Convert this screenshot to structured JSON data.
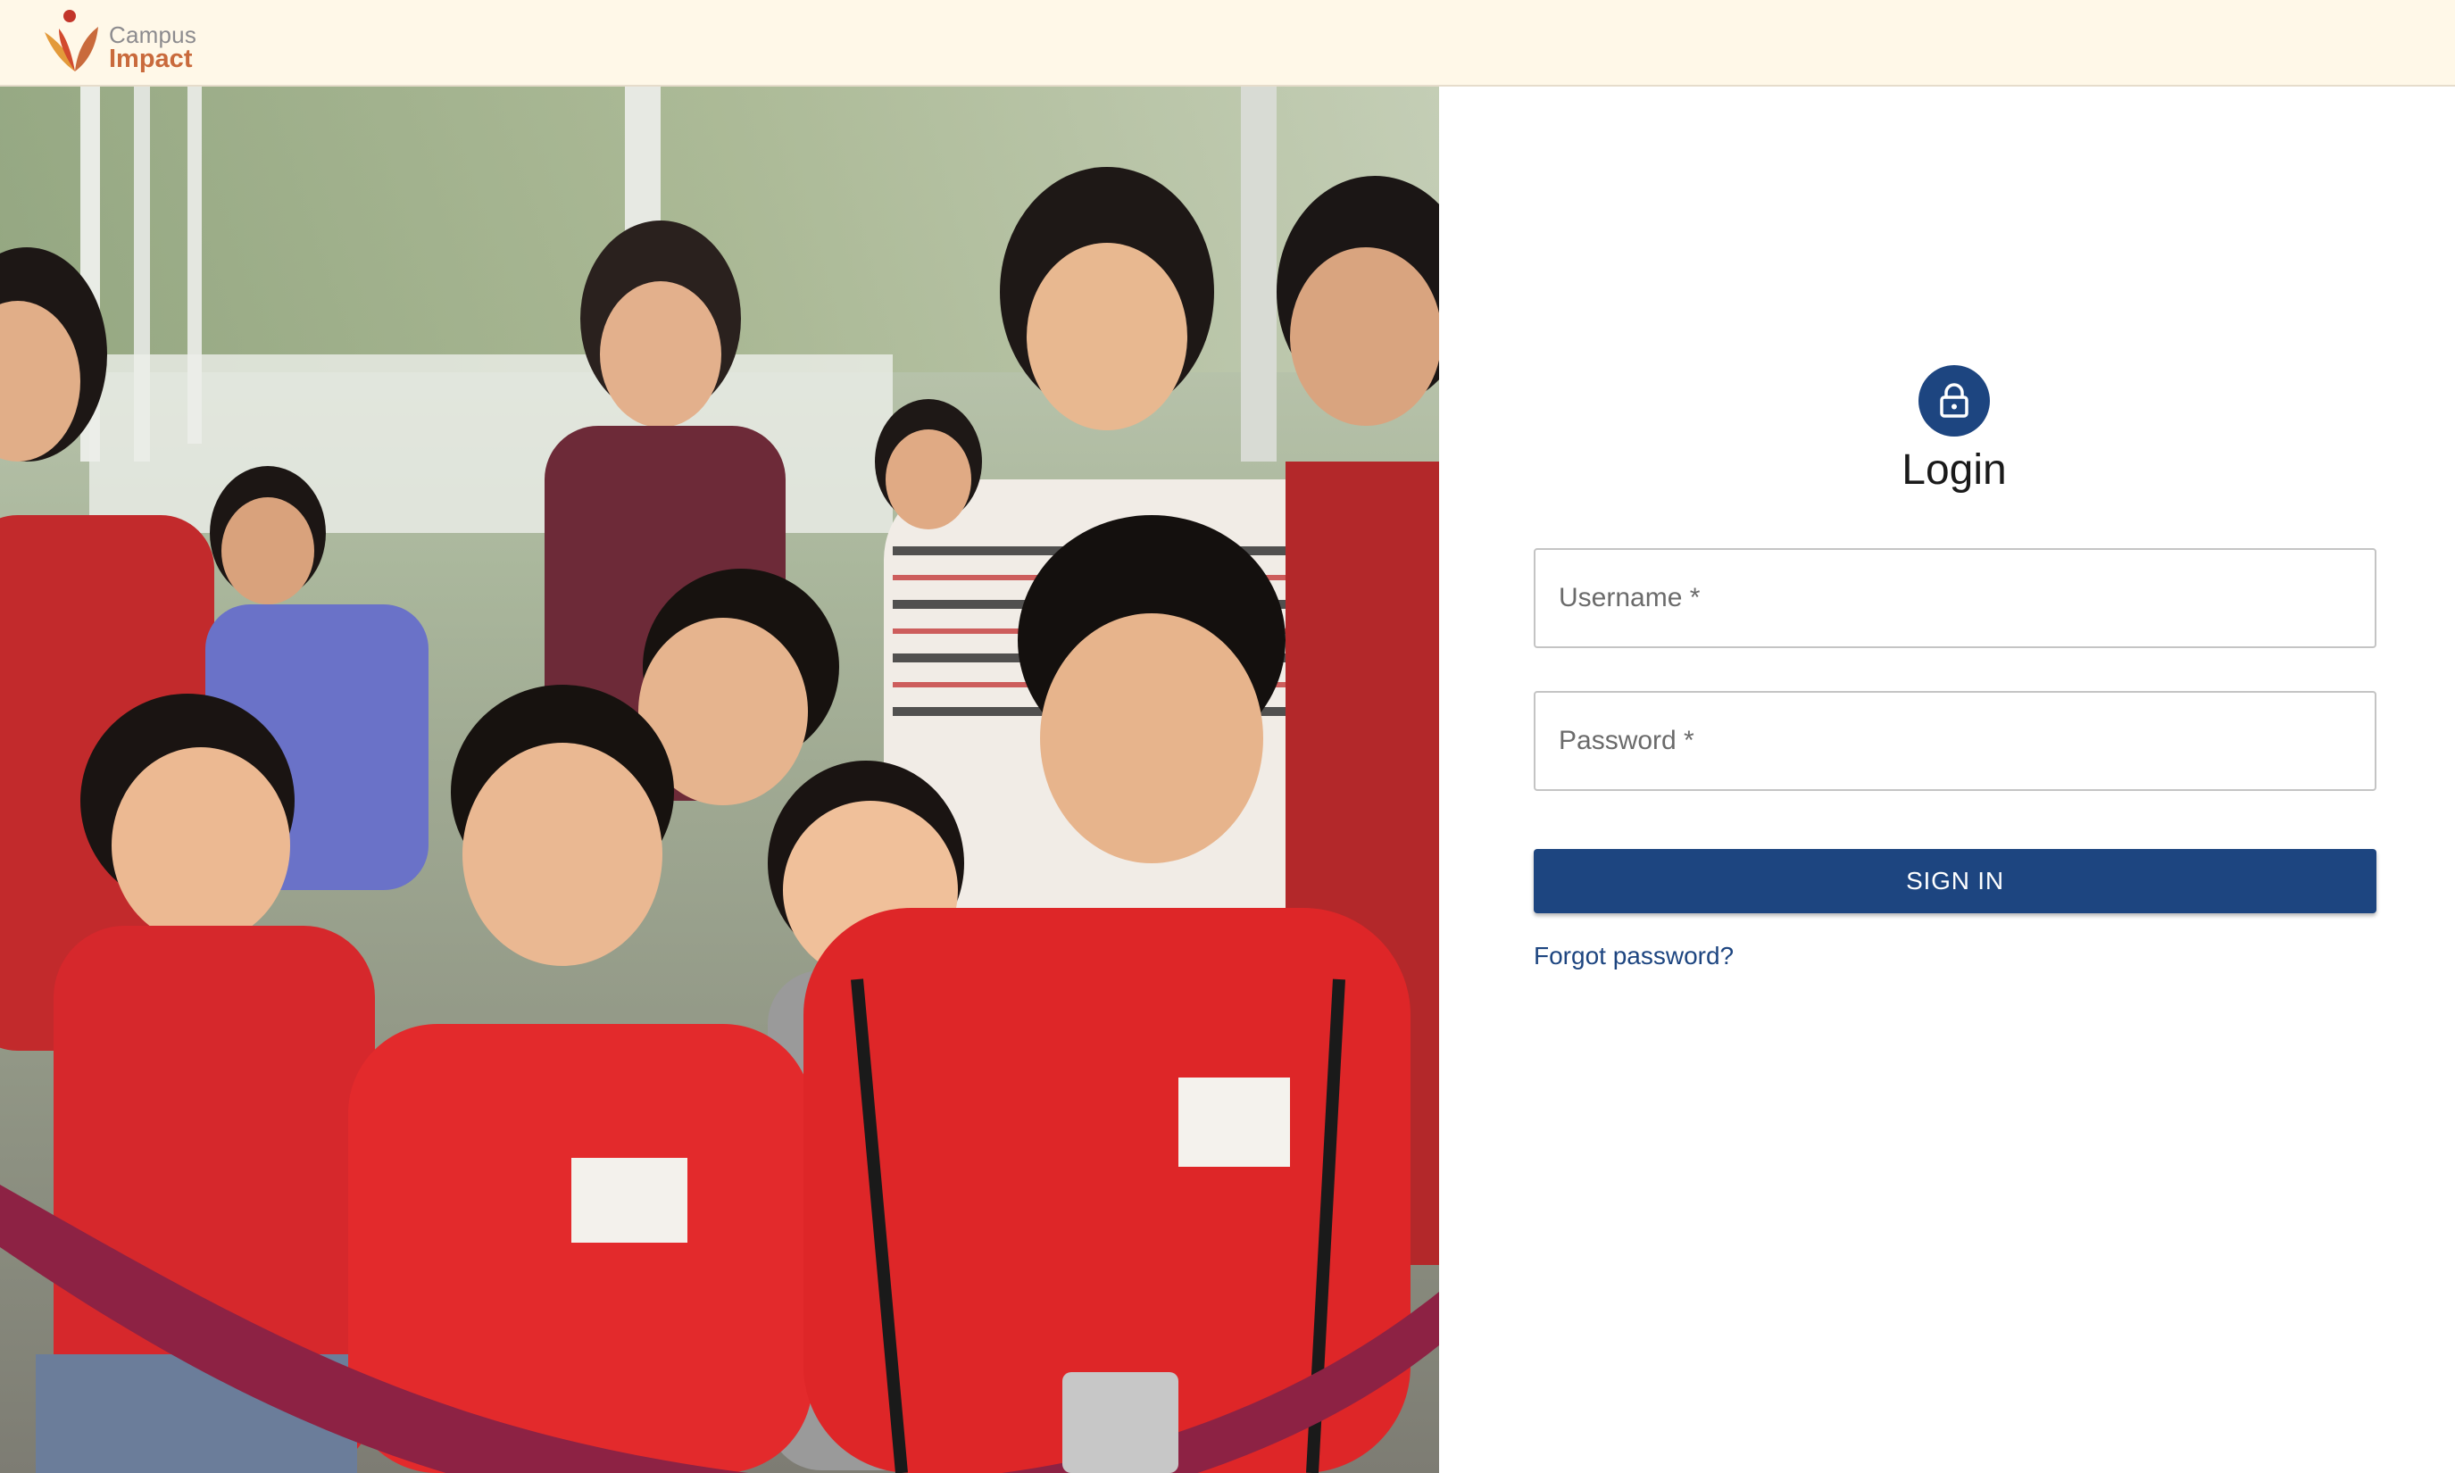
{
  "header": {
    "logo_line1": "Campus",
    "logo_line2": "Impact",
    "logo_icon": "campus-impact-logo-icon"
  },
  "hero": {
    "image_description": "group-photo"
  },
  "login": {
    "title": "Login",
    "lock_icon": "lock-icon",
    "username": {
      "placeholder": "Username *",
      "value": ""
    },
    "password": {
      "placeholder": "Password *",
      "value": ""
    },
    "sign_in_label": "SIGN IN",
    "forgot_password_label": "Forgot password?"
  },
  "colors": {
    "primary": "#1d4580",
    "header_bg": "#fff8e8",
    "logo_orange": "#c96a3c",
    "logo_grey": "#8c8b8e"
  }
}
